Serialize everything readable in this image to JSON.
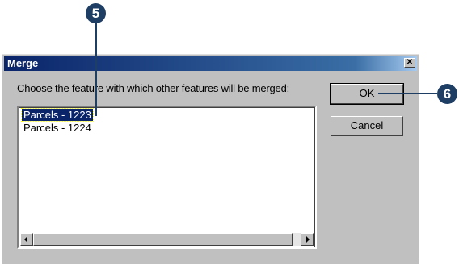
{
  "callouts": {
    "step5": "5",
    "step6": "6"
  },
  "dialog": {
    "title": "Merge",
    "close_glyph": "✕",
    "prompt": "Choose the feature with which other features will be merged:",
    "list": {
      "items": [
        {
          "label": "Parcels - 1223",
          "selected": true
        },
        {
          "label": "Parcels - 1224",
          "selected": false
        }
      ]
    },
    "buttons": {
      "ok_label": "OK",
      "cancel_label": "Cancel"
    }
  },
  "icons": {
    "close": "close-icon",
    "scroll_left": "arrow-left-icon",
    "scroll_right": "arrow-right-icon"
  },
  "colors": {
    "callout": "#1f3e64",
    "titlebar_start": "#0a246a",
    "titlebar_end": "#a6caf0",
    "selection": "#0a246a",
    "dialog_face": "#c0c0c0"
  }
}
